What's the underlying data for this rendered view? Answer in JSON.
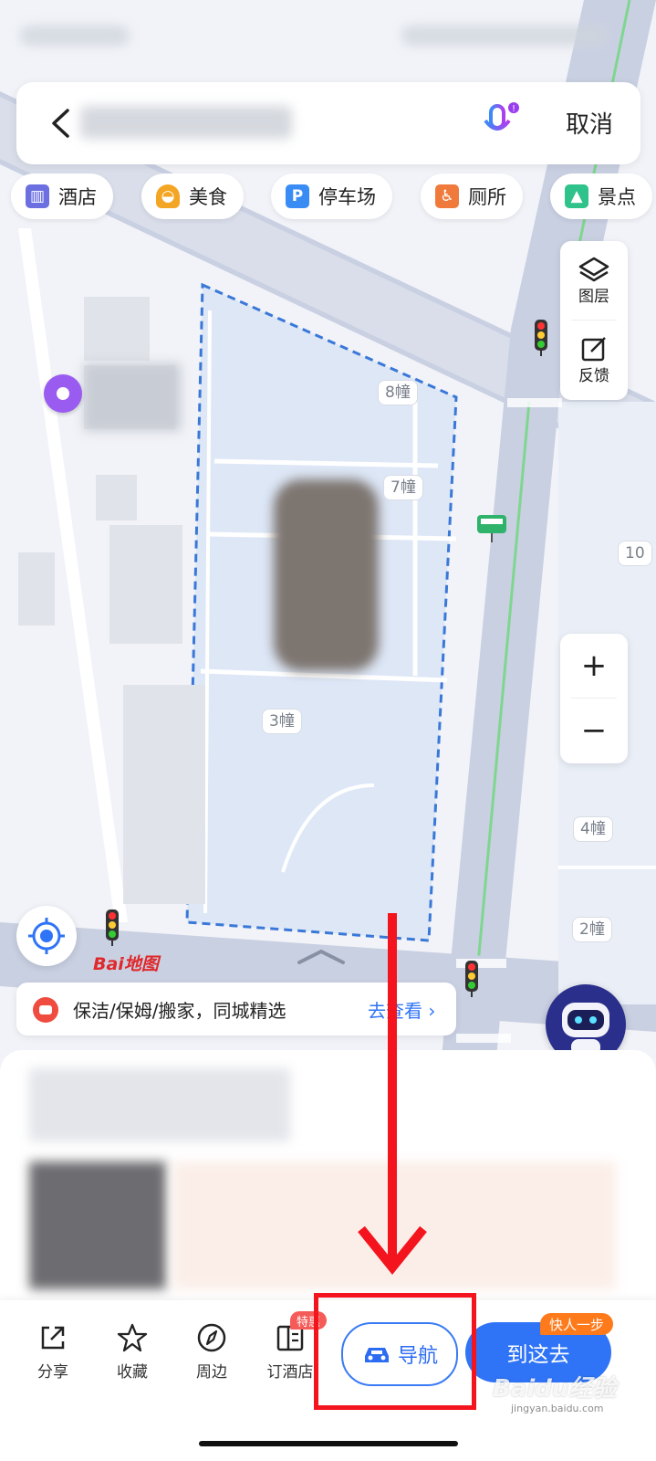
{
  "search": {
    "cancel_label": "取消"
  },
  "chips": [
    {
      "label": "酒店",
      "icon": "hotel-icon",
      "color": "#6b6fe0"
    },
    {
      "label": "美食",
      "icon": "food-icon",
      "color": "#f3a623"
    },
    {
      "label": "停车场",
      "icon": "parking-icon",
      "color": "#3a8cf5"
    },
    {
      "label": "厕所",
      "icon": "toilet-icon",
      "color": "#f07a3c"
    },
    {
      "label": "景点",
      "icon": "scenic-icon",
      "color": "#2fc28a"
    }
  ],
  "side_panel": {
    "layers_label": "图层",
    "feedback_label": "反馈"
  },
  "zoom": {
    "in_label": "+",
    "out_label": "−"
  },
  "map": {
    "building_labels": [
      "8幢",
      "7幢",
      "3幢",
      "4幢",
      "2幢",
      "10"
    ],
    "logo_text": "Bai地图"
  },
  "banner": {
    "text": "保洁/保姆/搬家，同城精选",
    "link": "去查看 ›"
  },
  "toolbar": {
    "share": "分享",
    "favorite": "收藏",
    "nearby": "周边",
    "book_hotel": "订酒店",
    "hotel_badge": "特惠",
    "navigate": "导航",
    "go_here": "到这去",
    "fast_badge": "快人一步"
  },
  "watermark": "Baidu经验",
  "watermark_sub": "jingyan.baidu.com",
  "colors": {
    "accent": "#2f74f6",
    "annotation": "#f4141e",
    "route_dash": "#3a78d8"
  }
}
